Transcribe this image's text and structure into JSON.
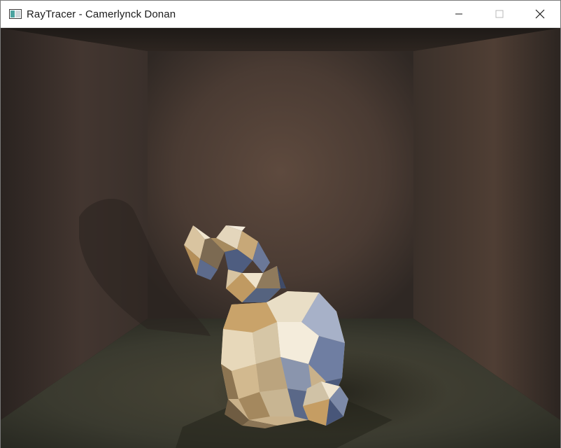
{
  "window": {
    "title": "RayTracer - Camerlynck Donan",
    "app_icon": "window-app-icon",
    "controls": {
      "minimize_icon": "minimize-icon",
      "maximize_icon": "maximize-icon",
      "close_icon": "close-icon"
    }
  },
  "scene": {
    "subject": "low-poly bunny",
    "environment": "box room",
    "colors": {
      "back_wall": "#5a473c",
      "side_wall": "#4a3b32",
      "floor": "#3c3b30",
      "ceiling": "#2c231e",
      "bunny_light": "#e8dcc8",
      "bunny_warm": "#c8a06a",
      "bunny_shadow": "#4a5a7e"
    }
  }
}
